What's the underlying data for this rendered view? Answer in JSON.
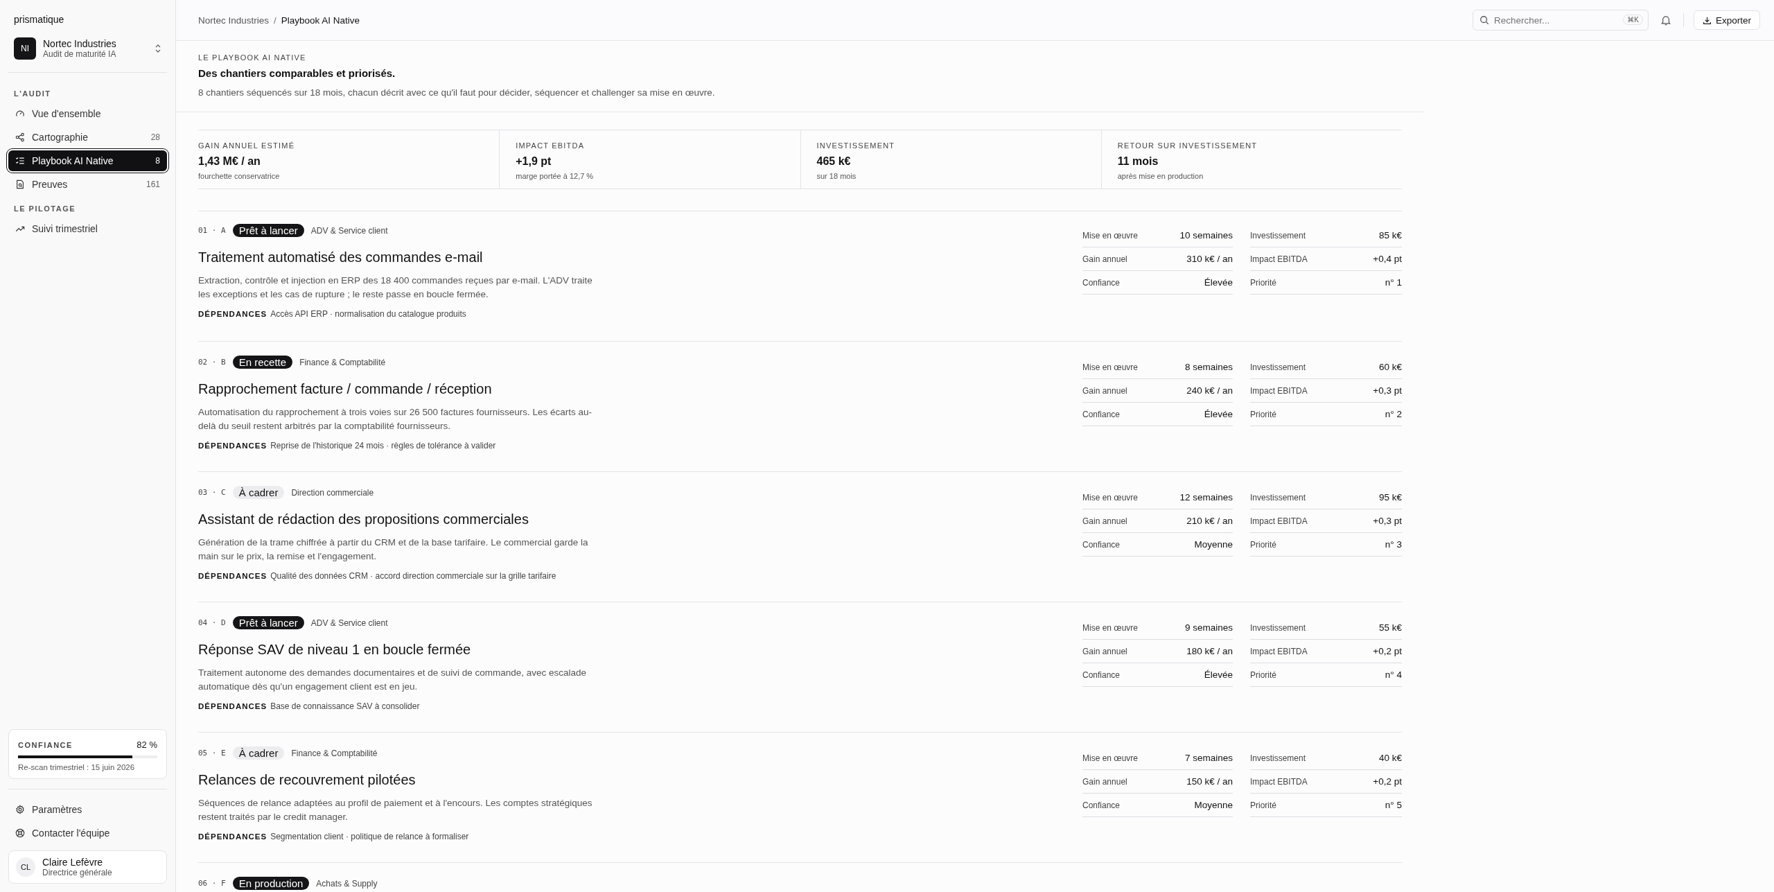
{
  "sidebar": {
    "brand": "prismatique",
    "org": {
      "initials": "NI",
      "name": "Nortec Industries",
      "subtitle": "Audit de maturité IA"
    },
    "sections": [
      {
        "title": "L'AUDIT",
        "items": [
          {
            "label": "Vue d'ensemble",
            "selected": false
          },
          {
            "label": "Cartographie",
            "count": "28",
            "selected": false
          },
          {
            "label": "Playbook AI Native",
            "count": "8",
            "selected": true
          },
          {
            "label": "Preuves",
            "count": "161",
            "selected": false
          }
        ]
      },
      {
        "title": "LE PILOTAGE",
        "items": [
          {
            "label": "Suivi trimestriel",
            "selected": false
          }
        ]
      }
    ],
    "confidence": {
      "label": "CONFIANCE",
      "reading": "82 %",
      "level": 0.82,
      "note": "Re-scan trimestriel : 15 juin 2026"
    },
    "footer_links": [
      {
        "label": "Paramètres"
      },
      {
        "label": "Contacter l'équipe"
      }
    ],
    "user": {
      "initials": "CL",
      "name": "Claire Lefèvre",
      "role": "Directrice générale"
    }
  },
  "topbar": {
    "breadcrumb": [
      "Nortec Industries",
      "Playbook AI Native"
    ],
    "separator": "/",
    "search": {
      "placeholder": "Rechercher...",
      "shortcut": "⌘K"
    },
    "export": "Exporter"
  },
  "header": {
    "eyebrow": "LE PLAYBOOK AI NATIVE",
    "title": "Des chantiers comparables et priorisés.",
    "description": "8 chantiers séquencés sur 18 mois, chacun décrit avec ce qu'il faut pour décider, séquencer et challenger sa mise en œuvre."
  },
  "kpis": [
    {
      "label": "GAIN ANNUEL ESTIMÉ",
      "value": "1,43 M€ / an",
      "note": "fourchette conservatrice"
    },
    {
      "label": "IMPACT EBITDA",
      "value": "+1,9 pt",
      "note": "marge portée à 12,7 %"
    },
    {
      "label": "INVESTISSEMENT",
      "value": "465 k€",
      "note": "sur 18 mois"
    },
    {
      "label": "RETOUR SUR INVESTISSEMENT",
      "value": "11 mois",
      "note": "après mise en production"
    }
  ],
  "projects": [
    {
      "number": "01 · A",
      "status": {
        "label": "Prêt à lancer",
        "kind": "solid"
      },
      "domain": "ADV & Service client",
      "title": "Traitement automatisé des commandes e-mail",
      "description": "Extraction, contrôle et injection en ERP des 18 400 commandes reçues par e-mail. L'ADV traite les exceptions et les cas de rupture ; le reste passe en boucle fermée.",
      "dependencies_label": "DÉPENDANCES",
      "dependencies": "Accès API ERP · normalisation du catalogue produits",
      "metrics": [
        {
          "label": "Mise en œuvre",
          "value": "10 semaines"
        },
        {
          "label": "Investissement",
          "value": "85 k€"
        },
        {
          "label": "Gain annuel",
          "value": "310 k€ / an"
        },
        {
          "label": "Impact EBITDA",
          "value": "+0,4 pt"
        },
        {
          "label": "Confiance",
          "value": "Élevée"
        },
        {
          "label": "Priorité",
          "value": "n° 1"
        }
      ]
    },
    {
      "number": "02 · B",
      "status": {
        "label": "En recette",
        "kind": "solid"
      },
      "domain": "Finance & Comptabilité",
      "title": "Rapprochement facture / commande / réception",
      "description": "Automatisation du rapprochement à trois voies sur 26 500 factures fournisseurs. Les écarts au-delà du seuil restent arbitrés par la comptabilité fournisseurs.",
      "dependencies_label": "DÉPENDANCES",
      "dependencies": "Reprise de l'historique 24 mois · règles de tolérance à valider",
      "metrics": [
        {
          "label": "Mise en œuvre",
          "value": "8 semaines"
        },
        {
          "label": "Investissement",
          "value": "60 k€"
        },
        {
          "label": "Gain annuel",
          "value": "240 k€ / an"
        },
        {
          "label": "Impact EBITDA",
          "value": "+0,3 pt"
        },
        {
          "label": "Confiance",
          "value": "Élevée"
        },
        {
          "label": "Priorité",
          "value": "n° 2"
        }
      ]
    },
    {
      "number": "03 · C",
      "status": {
        "label": "À cadrer",
        "kind": "soft"
      },
      "domain": "Direction commerciale",
      "title": "Assistant de rédaction des propositions commerciales",
      "description": "Génération de la trame chiffrée à partir du CRM et de la base tarifaire. Le commercial garde la main sur le prix, la remise et l'engagement.",
      "dependencies_label": "DÉPENDANCES",
      "dependencies": "Qualité des données CRM · accord direction commerciale sur la grille tarifaire",
      "metrics": [
        {
          "label": "Mise en œuvre",
          "value": "12 semaines"
        },
        {
          "label": "Investissement",
          "value": "95 k€"
        },
        {
          "label": "Gain annuel",
          "value": "210 k€ / an"
        },
        {
          "label": "Impact EBITDA",
          "value": "+0,3 pt"
        },
        {
          "label": "Confiance",
          "value": "Moyenne"
        },
        {
          "label": "Priorité",
          "value": "n° 3"
        }
      ]
    },
    {
      "number": "04 · D",
      "status": {
        "label": "Prêt à lancer",
        "kind": "solid"
      },
      "domain": "ADV & Service client",
      "title": "Réponse SAV de niveau 1 en boucle fermée",
      "description": "Traitement autonome des demandes documentaires et de suivi de commande, avec escalade automatique dès qu'un engagement client est en jeu.",
      "dependencies_label": "DÉPENDANCES",
      "dependencies": "Base de connaissance SAV à consolider",
      "metrics": [
        {
          "label": "Mise en œuvre",
          "value": "9 semaines"
        },
        {
          "label": "Investissement",
          "value": "55 k€"
        },
        {
          "label": "Gain annuel",
          "value": "180 k€ / an"
        },
        {
          "label": "Impact EBITDA",
          "value": "+0,2 pt"
        },
        {
          "label": "Confiance",
          "value": "Élevée"
        },
        {
          "label": "Priorité",
          "value": "n° 4"
        }
      ]
    },
    {
      "number": "05 · E",
      "status": {
        "label": "À cadrer",
        "kind": "soft"
      },
      "domain": "Finance & Comptabilité",
      "title": "Relances de recouvrement pilotées",
      "description": "Séquences de relance adaptées au profil de paiement et à l'encours. Les comptes stratégiques restent traités par le credit manager.",
      "dependencies_label": "DÉPENDANCES",
      "dependencies": "Segmentation client · politique de relance à formaliser",
      "metrics": [
        {
          "label": "Mise en œuvre",
          "value": "7 semaines"
        },
        {
          "label": "Investissement",
          "value": "40 k€"
        },
        {
          "label": "Gain annuel",
          "value": "150 k€ / an"
        },
        {
          "label": "Impact EBITDA",
          "value": "+0,2 pt"
        },
        {
          "label": "Confiance",
          "value": "Moyenne"
        },
        {
          "label": "Priorité",
          "value": "n° 5"
        }
      ]
    },
    {
      "number": "06 · F",
      "status": {
        "label": "En production",
        "kind": "solid"
      },
      "domain": "Achats & Supply"
    }
  ]
}
